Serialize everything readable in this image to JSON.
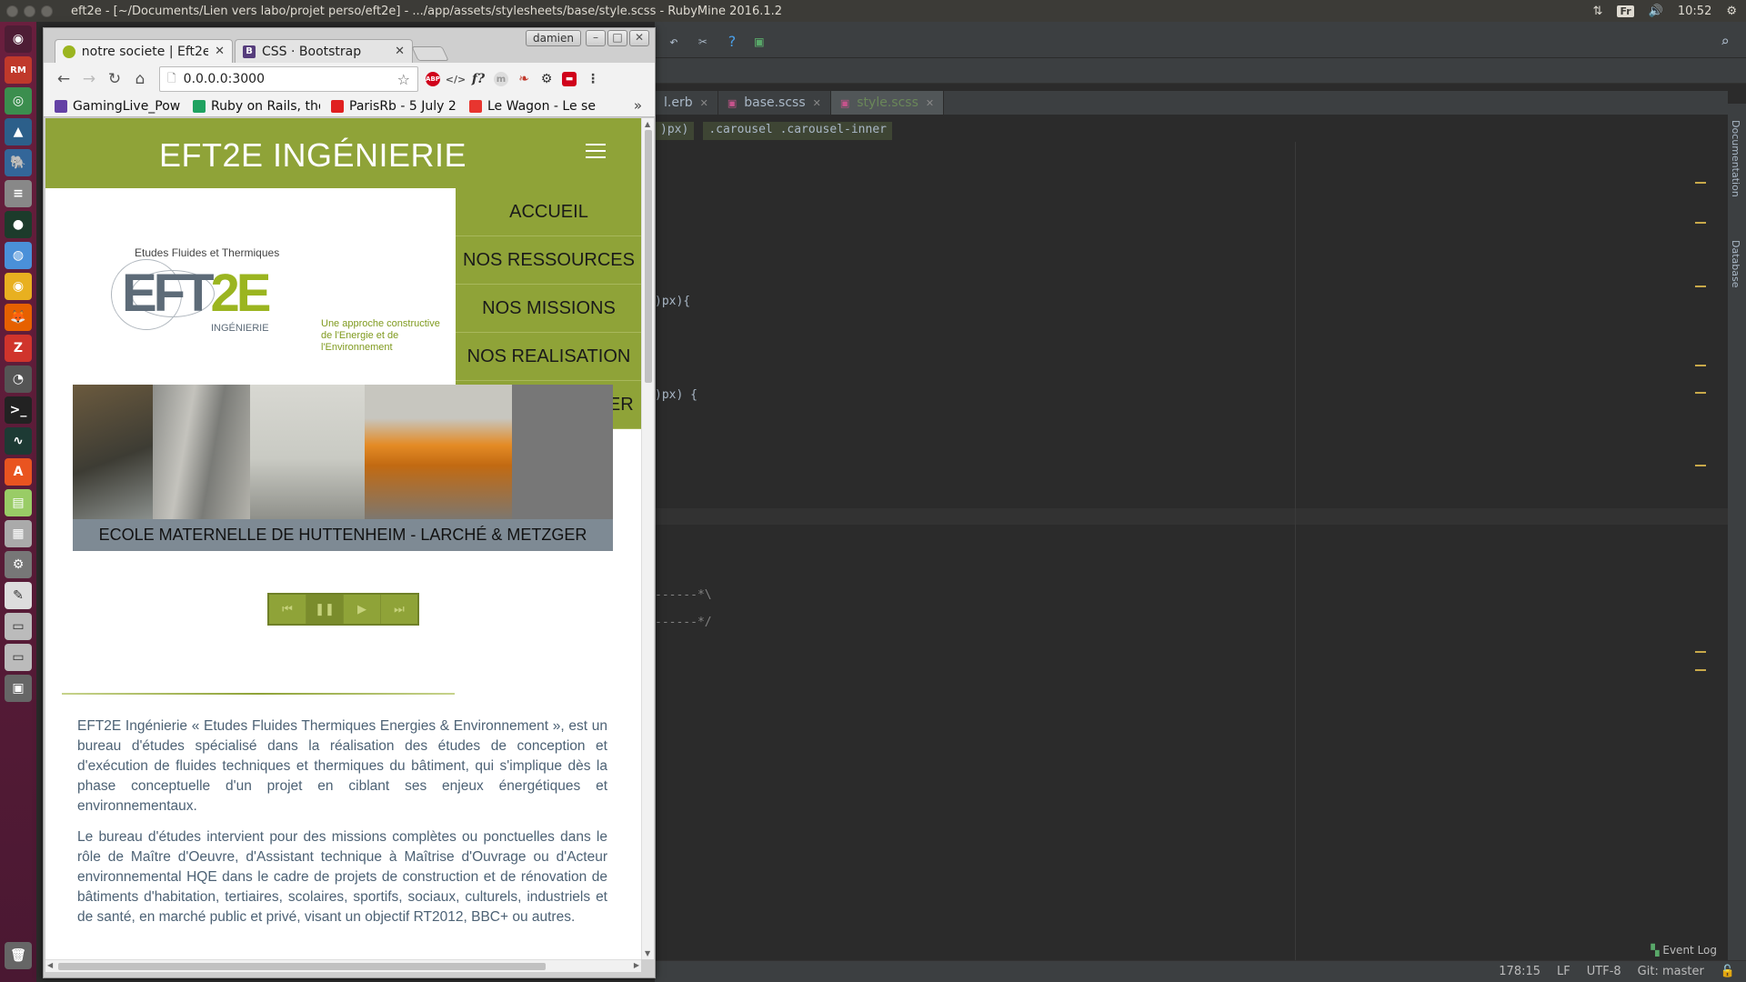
{
  "os": {
    "window_title": "eft2e - [~/Documents/Lien vers labo/projet perso/eft2e] - .../app/assets/stylesheets/base/style.scss - RubyMine 2016.1.2",
    "keyboard_layout": "Fr",
    "clock": "10:52"
  },
  "ide": {
    "tabs": [
      {
        "label": "l.erb"
      },
      {
        "label": "base.scss"
      },
      {
        "label": "style.scss"
      }
    ],
    "breadcrumb": [
      ")px)",
      ".carousel .carousel-inner"
    ],
    "code_lines": [
      {
        "text": ")px){"
      },
      {
        "text": ")px) {"
      },
      {
        "text": "------*\\"
      },
      {
        "text": "------*/"
      }
    ],
    "side_tabs": [
      "Documentation",
      "Database"
    ],
    "event_log": "Event Log",
    "status": {
      "position": "178:15",
      "line_sep": "LF",
      "encoding": "UTF-8",
      "vcs": "Git: master"
    }
  },
  "browser": {
    "user": "damien",
    "tabs": [
      {
        "label": "notre societe | Eft2e",
        "favicon_color": "#9bb520"
      },
      {
        "label": "CSS · Bootstrap",
        "favicon_color": "#563d7c"
      }
    ],
    "url": "0.0.0.0:3000",
    "bookmarks": [
      {
        "label": "GamingLive_Pow",
        "color": "#6441a5"
      },
      {
        "label": "Ruby on Rails, the",
        "color": "#1fa260"
      },
      {
        "label": "ParisRb - 5 July 2",
        "color": "#e02020"
      },
      {
        "label": "Le Wagon - Le se",
        "color": "#e8352f"
      }
    ],
    "bookmarks_more": "»"
  },
  "site": {
    "title": "EFT2E INGÉNIERIE",
    "menu": [
      "ACCUEIL",
      "NOS RESSOURCES",
      "NOS MISSIONS",
      "NOS REALISATION",
      "NOUS CONTACTER"
    ],
    "logo": {
      "tagline_top": "Etudes Fluides et Thermiques",
      "wordmark_a": "EFT",
      "wordmark_b": "2E",
      "sub": "INGÉNIERIE",
      "slogan_1": "Une approche constructive",
      "slogan_2": "de l'Energie et de l'Environnement"
    },
    "carousel_caption": "ECOLE MATERNELLE DE HUTTENHEIM - LARCHÉ & METZGER",
    "carousel_controls": [
      "first",
      "pause",
      "play",
      "last"
    ],
    "accent": "#8fa338",
    "paragraphs": [
      "EFT2E Ingénierie « Etudes Fluides Thermiques Energies & Environnement », est un bureau d'études spécialisé dans la réalisation des études de conception et d'exécution de fluides techniques et thermiques du bâtiment, qui s'implique dès la phase conceptuelle d'un projet en ciblant ses enjeux énergétiques et environnementaux.",
      "Le bureau d'études intervient pour des missions complètes ou ponctuelles dans le rôle de Maître d'Oeuvre, d'Assistant technique à Maîtrise d'Ouvrage ou d'Acteur environnemental HQE dans le cadre de projets de construction et de rénovation de bâtiments d'habitation, tertiaires, scolaires, sportifs, sociaux, culturels, industriels et de santé, en marché public et privé, visant un objectif RT2012, BBC+ ou autres."
    ]
  }
}
